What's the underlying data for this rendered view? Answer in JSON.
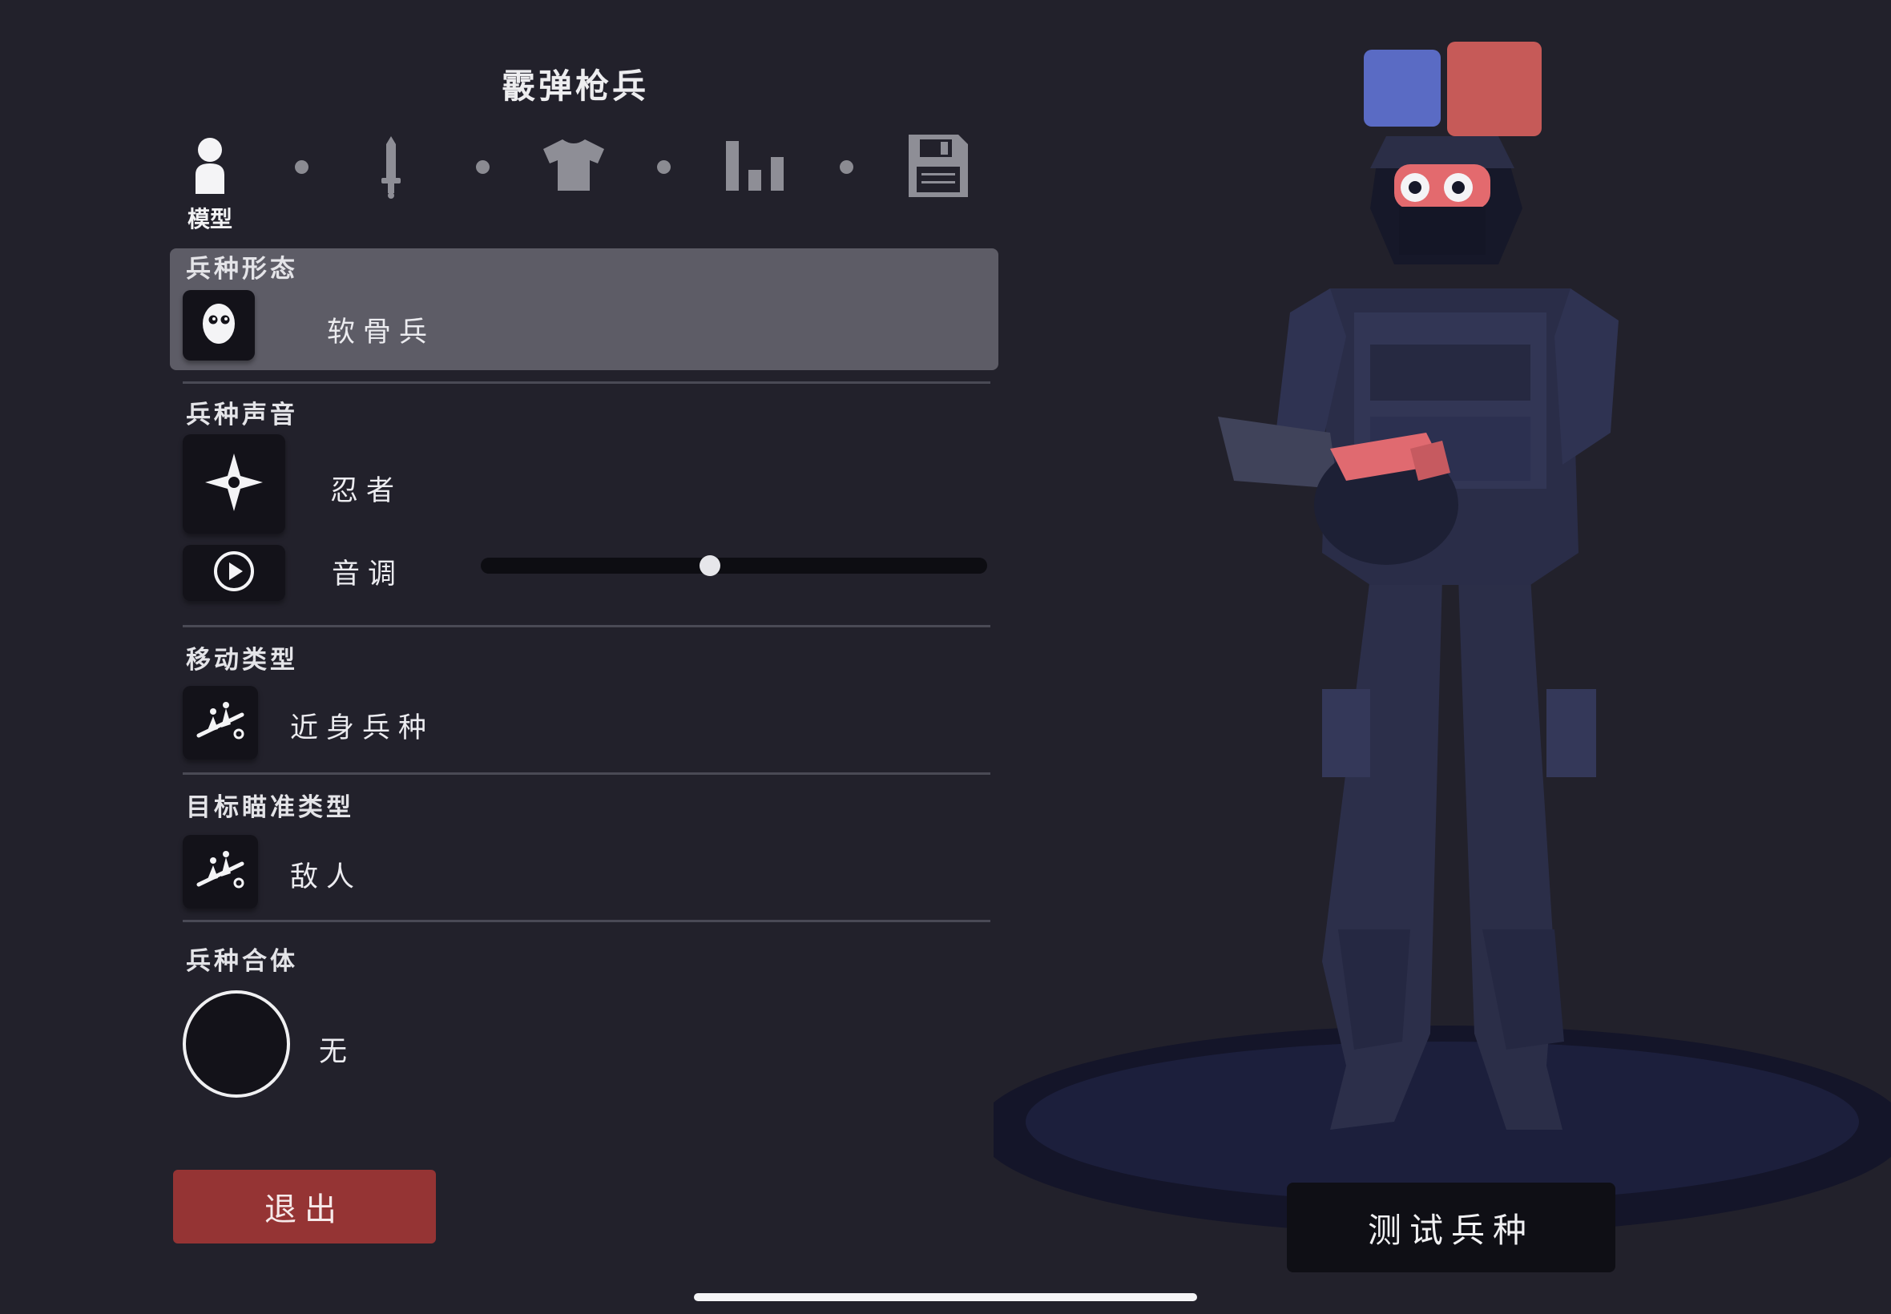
{
  "unit_name": "霰弹枪兵",
  "tabs": [
    {
      "icon": "person-icon",
      "label": "模型",
      "active": true
    },
    {
      "icon": "sword-icon",
      "label": ""
    },
    {
      "icon": "shirt-icon",
      "label": ""
    },
    {
      "icon": "bar-chart-icon",
      "label": ""
    },
    {
      "icon": "floppy-disk-icon",
      "label": ""
    }
  ],
  "sections": {
    "form": {
      "label": "兵种形态",
      "value": "软骨兵",
      "icon": "ragdoll-face-icon"
    },
    "voice": {
      "label": "兵种声音",
      "value": "忍者",
      "icon": "shuriken-icon",
      "pitch_label": "音调",
      "pitch_icon": "play-icon",
      "pitch_value": 0.45
    },
    "movement": {
      "label": "移动类型",
      "value": "近身兵种",
      "icon": "melee-units-icon"
    },
    "targeting": {
      "label": "目标瞄准类型",
      "value": "敌人",
      "icon": "melee-units-icon"
    },
    "combine": {
      "label": "兵种合体",
      "value": "无"
    }
  },
  "buttons": {
    "exit": "退出",
    "test": "测试兵种"
  },
  "colors": {
    "background": "#22212b",
    "team_blue": "#5a6bc4",
    "team_red": "#c65a58",
    "exit": "#953434"
  }
}
